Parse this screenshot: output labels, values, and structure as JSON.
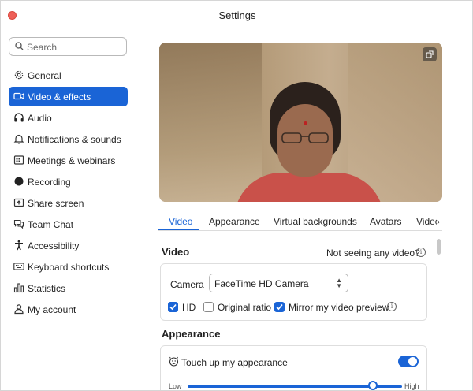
{
  "window": {
    "title": "Settings"
  },
  "search": {
    "placeholder": "Search"
  },
  "sidebar": {
    "items": [
      {
        "label": "General",
        "icon": "gear-icon",
        "active": false
      },
      {
        "label": "Video & effects",
        "icon": "video-camera-icon",
        "active": true
      },
      {
        "label": "Audio",
        "icon": "headphones-icon",
        "active": false
      },
      {
        "label": "Notifications & sounds",
        "icon": "bell-icon",
        "active": false
      },
      {
        "label": "Meetings & webinars",
        "icon": "calendar-icon",
        "active": false
      },
      {
        "label": "Recording",
        "icon": "record-icon",
        "active": false
      },
      {
        "label": "Share screen",
        "icon": "share-screen-icon",
        "active": false
      },
      {
        "label": "Team Chat",
        "icon": "chat-icon",
        "active": false
      },
      {
        "label": "Accessibility",
        "icon": "accessibility-icon",
        "active": false
      },
      {
        "label": "Keyboard shortcuts",
        "icon": "keyboard-icon",
        "active": false
      },
      {
        "label": "Statistics",
        "icon": "statistics-icon",
        "active": false
      },
      {
        "label": "My account",
        "icon": "person-icon",
        "active": false
      }
    ]
  },
  "tabs": {
    "items": [
      "Video",
      "Appearance",
      "Virtual backgrounds",
      "Avatars",
      "Videc"
    ],
    "active": "Video"
  },
  "video_section": {
    "title": "Video",
    "help_link": "Not seeing any video?",
    "camera_label": "Camera",
    "camera_value": "FaceTime HD Camera",
    "options": [
      {
        "label": "HD",
        "checked": true
      },
      {
        "label": "Original ratio",
        "checked": false
      },
      {
        "label": "Mirror my video preview",
        "checked": true
      }
    ]
  },
  "appearance_section": {
    "title": "Appearance",
    "touch_up_label": "Touch up my appearance",
    "touch_up_enabled": true,
    "slider_low": "Low",
    "slider_high": "High",
    "slider_level": 0.87
  },
  "colors": {
    "accent": "#1a64d6",
    "close": "#ee5f58"
  }
}
